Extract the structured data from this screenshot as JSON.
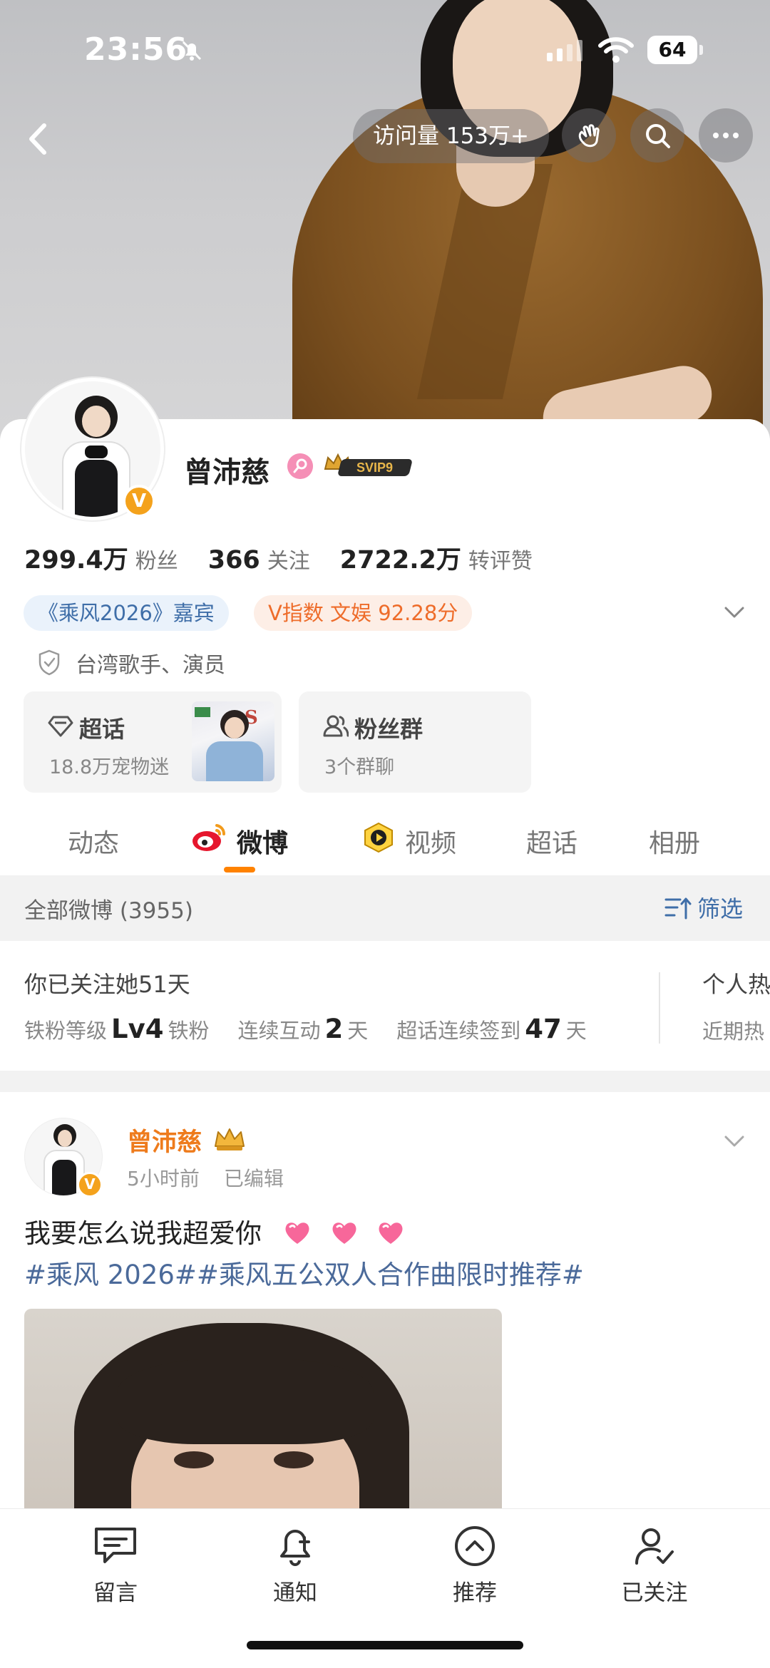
{
  "status_bar": {
    "time": "23:56",
    "battery": "64"
  },
  "header": {
    "visits": "访问量 153万+"
  },
  "profile": {
    "name": "曾沛慈",
    "svip": "SVIP9",
    "badge": "V",
    "stats": [
      {
        "value": "299.4万",
        "label": "粉丝"
      },
      {
        "value": "366",
        "label": "关注"
      },
      {
        "value": "2722.2万",
        "label": "转评赞"
      }
    ],
    "tags": {
      "guest": "《乘风2026》嘉宾",
      "index": "V指数 文娱 92.28分"
    },
    "verification": "台湾歌手、演员",
    "super_topic": {
      "title": "超话",
      "subtitle": "18.8万宠物迷"
    },
    "fan_group": {
      "title": "粉丝群",
      "subtitle": "3个群聊"
    }
  },
  "tabs": [
    {
      "label": "动态"
    },
    {
      "label": "微博"
    },
    {
      "label": "视频"
    },
    {
      "label": "超话"
    },
    {
      "label": "相册"
    }
  ],
  "filter": {
    "count_label": "全部微博 (3955)",
    "filter_label": "筛选"
  },
  "fan_info": {
    "follow_days": "你已关注她51天",
    "level_label": "铁粉等级",
    "level_value": "Lv4",
    "level_suffix": "铁粉",
    "interact_label": "连续互动",
    "interact_value": "2",
    "interact_unit": "天",
    "checkin_label": "超话连续签到",
    "checkin_value": "47",
    "checkin_unit": "天",
    "right_title": "个人热",
    "right_sub": "近期热"
  },
  "post": {
    "author": "曾沛慈",
    "time": "5小时前",
    "edited": "已编辑",
    "text": "我要怎么说我超爱你",
    "topics": "#乘风 2026##乘风五公双人合作曲限时推荐#"
  },
  "bottom_bar": [
    {
      "label": "留言",
      "icon": "message-icon"
    },
    {
      "label": "通知",
      "icon": "bell-plus-icon"
    },
    {
      "label": "推荐",
      "icon": "chevron-up-circle-icon"
    },
    {
      "label": "已关注",
      "icon": "user-check-icon"
    }
  ],
  "colors": {
    "accent_orange": "#ff8200",
    "link_blue": "#3f6ea8",
    "name_orange": "#ee7b1c"
  }
}
